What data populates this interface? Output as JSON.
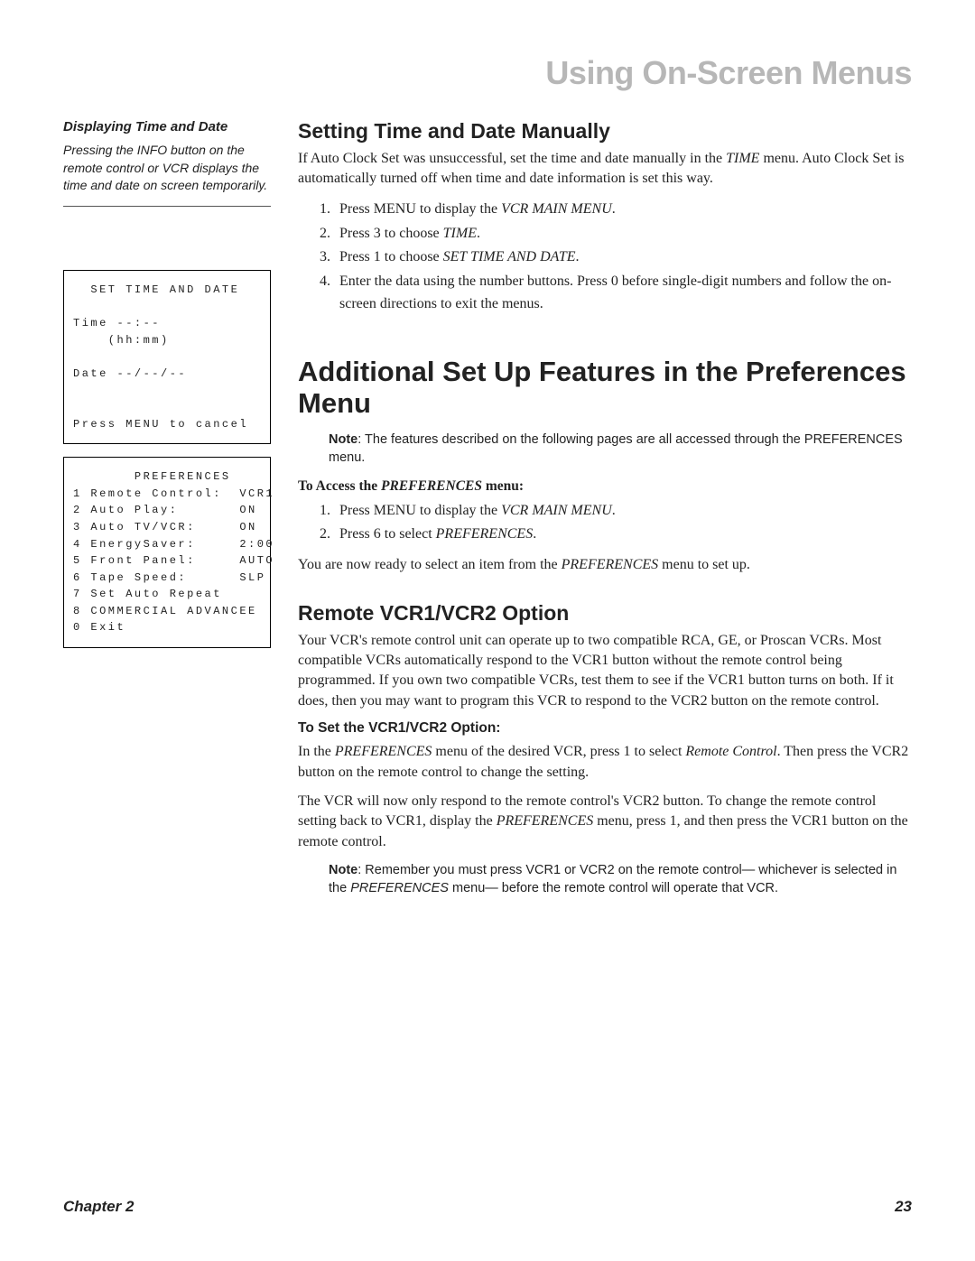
{
  "header": {
    "chapter_title": "Using On-Screen Menus"
  },
  "sidebar": {
    "tip_head": "Displaying Time and Date",
    "tip_text": "Pressing the INFO button on the remote control or VCR displays the time and date on screen temporarily.",
    "screen1": {
      "l1": "  SET TIME AND DATE",
      "l2": "",
      "l3": "Time --:--",
      "l4": "    (hh:mm)",
      "l5": "",
      "l6": "Date --/--/--",
      "l7": "",
      "l8": "",
      "l9": "Press MENU to cancel"
    },
    "screen2": {
      "l1": "       PREFERENCES",
      "l2": "1 Remote Control:  VCR1",
      "l3": "2 Auto Play:       ON",
      "l4": "3 Auto TV/VCR:     ON",
      "l5": "4 EnergySaver:     2:00",
      "l6": "5 Front Panel:     AUTO",
      "l7": "6 Tape Speed:      SLP",
      "l8": "7 Set Auto Repeat",
      "l9": "8 COMMERCIAL ADVANCEE",
      "l0": "0 Exit"
    }
  },
  "main": {
    "h2a": "Setting Time and Date Manually",
    "p1a": "If Auto Clock Set was unsuccessful, set the time and date manually in the ",
    "p1b": "TIME",
    "p1c": " menu. Auto Clock Set is automatically turned off when time and date information is set this way.",
    "steps1": {
      "s1a": "Press MENU to display the ",
      "s1b": "VCR MAIN MENU",
      "s1c": ".",
      "s2a": "Press 3 to choose ",
      "s2b": "TIME",
      "s2c": ".",
      "s3a": "Press 1 to choose ",
      "s3b": "SET TIME AND DATE",
      "s3c": ".",
      "s4": "Enter the data using the number buttons. Press 0 before single-digit numbers and follow the on-screen directions to exit the menus."
    },
    "h1": "Additional Set Up Features in the Preferences Menu",
    "note1a": "Note",
    "note1b": ": The features described on the following pages are all accessed through the PREFERENCES menu.",
    "run1a": "To Access the ",
    "run1b": "PREFERENCES",
    "run1c": " menu:",
    "steps2": {
      "s1a": "Press MENU to display the ",
      "s1b": "VCR MAIN MENU",
      "s1c": ".",
      "s2a": "Press 6 to select ",
      "s2b": "PREFERENCES",
      "s2c": "."
    },
    "p2a": "You are now ready to select an item from the ",
    "p2b": "PREFERENCES",
    "p2c": " menu to set up.",
    "h2b": "Remote VCR1/VCR2 Option",
    "p3": "Your VCR's remote control unit can operate up to two compatible RCA, GE, or Proscan VCRs. Most compatible VCRs automatically respond to the VCR1 button without the remote control being programmed. If you own two compatible VCRs, test them to see if the VCR1 button turns on both. If it does, then you may want to program this VCR to respond to the VCR2 button on the remote control.",
    "run2": "To Set the VCR1/VCR2 Option:",
    "p4a": "In the ",
    "p4b": "PREFERENCES",
    "p4c": " menu of the desired VCR, press 1 to select ",
    "p4d": "Remote Control",
    "p4e": ". Then press the VCR2 button on the remote control to change the setting.",
    "p5a": "The VCR will now only respond to the remote control's VCR2 button. To change the remote control setting back to VCR1, display the ",
    "p5b": "PREFERENCES",
    "p5c": " menu, press 1, and then press the VCR1 button on the remote control.",
    "note2a": "Note",
    "note2b": ": Remember you must press VCR1 or VCR2 on the remote control— whichever is selected in the ",
    "note2c": "PREFERENCES",
    "note2d": " menu— before the remote control will operate that VCR."
  },
  "footer": {
    "left": "Chapter 2",
    "right": "23"
  }
}
